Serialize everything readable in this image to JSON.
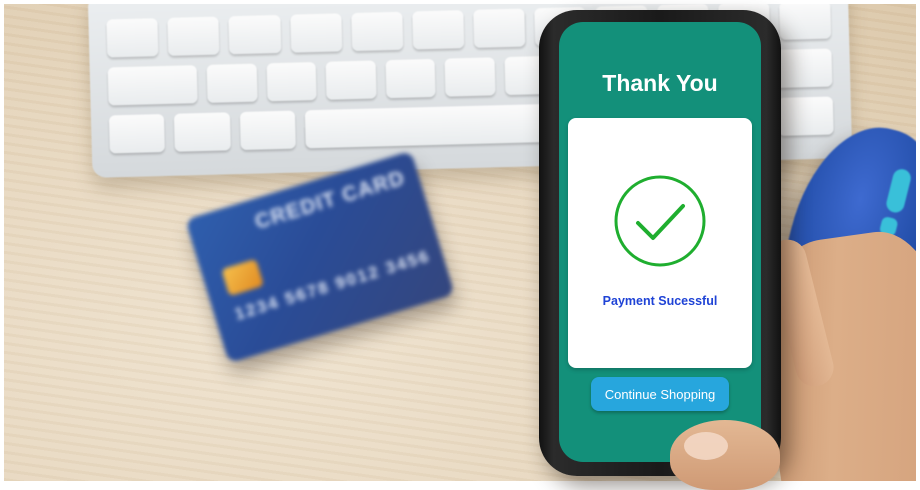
{
  "screen": {
    "title": "Thank You",
    "status_message": "Payment Sucessful",
    "continue_label": "Continue Shopping"
  },
  "background": {
    "card_title": "CREDIT CARD",
    "card_number": "1234 5678 9012 3456"
  },
  "colors": {
    "screen_bg": "#13907a",
    "check_green": "#1fae2f",
    "success_text": "#1f43d6",
    "button_bg": "#27a6dd"
  },
  "icons": {
    "success": "check-circle-icon"
  }
}
